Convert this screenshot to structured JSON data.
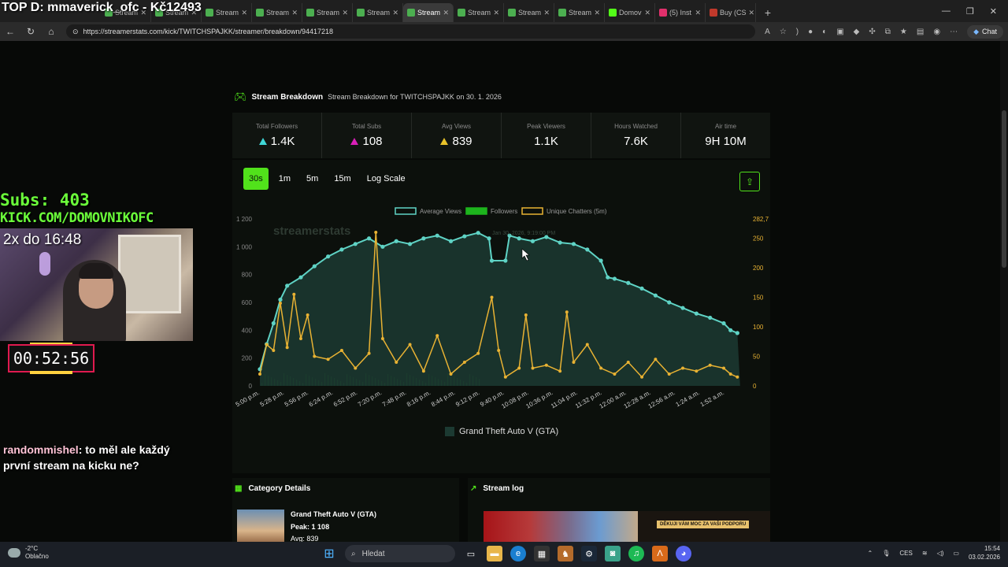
{
  "overlay_title": "TOP D: mmaverick_ofc - Kč12493",
  "tabs": [
    {
      "label": "Stream",
      "color": "#4caf50",
      "active": false
    },
    {
      "label": "Stream",
      "color": "#4caf50",
      "active": false
    },
    {
      "label": "Stream",
      "color": "#4caf50",
      "active": false
    },
    {
      "label": "Stream",
      "color": "#4caf50",
      "active": false
    },
    {
      "label": "Stream",
      "color": "#4caf50",
      "active": false
    },
    {
      "label": "Stream",
      "color": "#4caf50",
      "active": false
    },
    {
      "label": "Stream",
      "color": "#4caf50",
      "active": true
    },
    {
      "label": "Stream",
      "color": "#4caf50",
      "active": false
    },
    {
      "label": "Stream",
      "color": "#4caf50",
      "active": false
    },
    {
      "label": "Stream",
      "color": "#4caf50",
      "active": false
    },
    {
      "label": "Domov",
      "color": "#53fc18",
      "active": false
    },
    {
      "label": "(5) Inst",
      "color": "#e1306c",
      "active": false
    },
    {
      "label": "Buy (CS",
      "color": "#c0392b",
      "active": false
    }
  ],
  "address": {
    "url": "https://streamerstats.com/kick/TWITCHSPAJKK/streamer/breakdown/94417218",
    "chat_label": "Chat"
  },
  "stream_overlay": {
    "subs": "Subs: 403",
    "kick_url": "KICK.COM/DOMOVNIKOFC",
    "cam_text": "2x do 16:48",
    "timer": "00:52:56",
    "chat_user": "randommishel",
    "chat_text": ": to měl ale každý první stream na kicku ne?"
  },
  "breakdown": {
    "title": "Stream Breakdown",
    "subtitle": "Stream Breakdown for TWITCHSPAJKK on 30. 1. 2026"
  },
  "stats": [
    {
      "label": "Total Followers",
      "value": "1.4K",
      "icon_color": "#3fd6d6",
      "icon": "triangle-up-icon"
    },
    {
      "label": "Total Subs",
      "value": "108",
      "icon_color": "#d91fb8",
      "icon": "triangle-up-icon"
    },
    {
      "label": "Avg Views",
      "value": "839",
      "icon_color": "#e8c22a",
      "icon": "triangle-up-icon"
    },
    {
      "label": "Peak Viewers",
      "value": "1.1K"
    },
    {
      "label": "Hours Watched",
      "value": "7.6K"
    },
    {
      "label": "Air time",
      "value": "9H 10M"
    }
  ],
  "time_buttons": [
    "30s",
    "1m",
    "5m",
    "15m",
    "Log Scale"
  ],
  "active_time_button": "30s",
  "category_legend": "Grand Theft Auto V (GTA)",
  "category_details": {
    "title": "Category Details",
    "game": "Grand Theft Auto V (GTA)",
    "peak_label": "Peak:",
    "peak_value": "1 108",
    "avg_label": "Avg: 839"
  },
  "stream_log": {
    "title": "Stream log",
    "banner_text": "DĚKUJI VÁM MOC ZA VAŠI PODPORU"
  },
  "taskbar": {
    "temp": "-2°C",
    "weather": "Oblačno",
    "search": "Hledat",
    "lang": "CES",
    "time": "15:54",
    "date": "03.02.2026"
  },
  "chart_data": {
    "type": "line",
    "watermark": "streamerstats",
    "legend": [
      "Average Views",
      "Followers",
      "Unique Chatters (5m)"
    ],
    "colors": {
      "views": "#5fd3c5",
      "followers": "#1db41d",
      "chatters": "#e8b233",
      "fill": "#1c3a32"
    },
    "x_labels": [
      "5:00 p.m.",
      "5:28 p.m.",
      "5:56 p.m.",
      "6:24 p.m.",
      "6:52 p.m.",
      "7:20 p.m.",
      "7:48 p.m.",
      "8:16 p.m.",
      "8:44 p.m.",
      "9:12 p.m.",
      "9:40 p.m.",
      "10:08 p.m.",
      "10:36 p.m.",
      "11:04 p.m.",
      "11:32 p.m.",
      "12:00 a.m.",
      "12:28 a.m.",
      "12:56 a.m.",
      "1:24 a.m.",
      "1:52 a.m."
    ],
    "y_left": {
      "ticks": [
        "0",
        "200",
        "400",
        "600",
        "800",
        "1 000",
        "1 200"
      ],
      "ylim": [
        0,
        1200
      ]
    },
    "y_right": {
      "ticks": [
        "0",
        "50",
        "100",
        "150",
        "200",
        "250"
      ],
      "max_label": "282,7",
      "ylim": [
        0,
        282.7
      ]
    },
    "tooltip": "Jan 30, 2026, 9:19:00 PM",
    "views_series": [
      {
        "x": 0,
        "y": 120
      },
      {
        "x": 0.5,
        "y": 300
      },
      {
        "x": 1,
        "y": 450
      },
      {
        "x": 1.5,
        "y": 620
      },
      {
        "x": 2,
        "y": 720
      },
      {
        "x": 3,
        "y": 780
      },
      {
        "x": 4,
        "y": 860
      },
      {
        "x": 5,
        "y": 930
      },
      {
        "x": 6,
        "y": 980
      },
      {
        "x": 7,
        "y": 1020
      },
      {
        "x": 8,
        "y": 1060
      },
      {
        "x": 9,
        "y": 1000
      },
      {
        "x": 10,
        "y": 1040
      },
      {
        "x": 11,
        "y": 1020
      },
      {
        "x": 12,
        "y": 1060
      },
      {
        "x": 13,
        "y": 1080
      },
      {
        "x": 14,
        "y": 1040
      },
      {
        "x": 15,
        "y": 1075
      },
      {
        "x": 16,
        "y": 1100
      },
      {
        "x": 16.8,
        "y": 1060
      },
      {
        "x": 17,
        "y": 900
      },
      {
        "x": 18,
        "y": 900
      },
      {
        "x": 18.3,
        "y": 1080
      },
      {
        "x": 19,
        "y": 1060
      },
      {
        "x": 20,
        "y": 1040
      },
      {
        "x": 21,
        "y": 1070
      },
      {
        "x": 22,
        "y": 1030
      },
      {
        "x": 23,
        "y": 1020
      },
      {
        "x": 24,
        "y": 980
      },
      {
        "x": 25,
        "y": 900
      },
      {
        "x": 25.5,
        "y": 780
      },
      {
        "x": 26,
        "y": 770
      },
      {
        "x": 27,
        "y": 740
      },
      {
        "x": 28,
        "y": 700
      },
      {
        "x": 29,
        "y": 650
      },
      {
        "x": 30,
        "y": 600
      },
      {
        "x": 31,
        "y": 560
      },
      {
        "x": 32,
        "y": 520
      },
      {
        "x": 33,
        "y": 490
      },
      {
        "x": 34,
        "y": 450
      },
      {
        "x": 34.5,
        "y": 400
      },
      {
        "x": 35,
        "y": 380
      },
      {
        "x": 35.2,
        "y": 0
      }
    ],
    "chatters_series": [
      {
        "x": 0,
        "y": 20
      },
      {
        "x": 0.5,
        "y": 70
      },
      {
        "x": 1,
        "y": 60
      },
      {
        "x": 1.5,
        "y": 140
      },
      {
        "x": 2,
        "y": 65
      },
      {
        "x": 2.5,
        "y": 155
      },
      {
        "x": 3,
        "y": 80
      },
      {
        "x": 3.5,
        "y": 120
      },
      {
        "x": 4,
        "y": 50
      },
      {
        "x": 5,
        "y": 45
      },
      {
        "x": 6,
        "y": 60
      },
      {
        "x": 7,
        "y": 30
      },
      {
        "x": 8,
        "y": 55
      },
      {
        "x": 8.5,
        "y": 260
      },
      {
        "x": 9,
        "y": 80
      },
      {
        "x": 10,
        "y": 40
      },
      {
        "x": 11,
        "y": 70
      },
      {
        "x": 12,
        "y": 25
      },
      {
        "x": 13,
        "y": 85
      },
      {
        "x": 14,
        "y": 20
      },
      {
        "x": 15,
        "y": 40
      },
      {
        "x": 16,
        "y": 55
      },
      {
        "x": 17,
        "y": 150
      },
      {
        "x": 17.5,
        "y": 60
      },
      {
        "x": 18,
        "y": 15
      },
      {
        "x": 19,
        "y": 30
      },
      {
        "x": 19.5,
        "y": 120
      },
      {
        "x": 20,
        "y": 30
      },
      {
        "x": 21,
        "y": 35
      },
      {
        "x": 22,
        "y": 25
      },
      {
        "x": 22.5,
        "y": 125
      },
      {
        "x": 23,
        "y": 40
      },
      {
        "x": 24,
        "y": 70
      },
      {
        "x": 25,
        "y": 30
      },
      {
        "x": 26,
        "y": 20
      },
      {
        "x": 27,
        "y": 40
      },
      {
        "x": 28,
        "y": 15
      },
      {
        "x": 29,
        "y": 45
      },
      {
        "x": 30,
        "y": 20
      },
      {
        "x": 31,
        "y": 30
      },
      {
        "x": 32,
        "y": 25
      },
      {
        "x": 33,
        "y": 35
      },
      {
        "x": 34,
        "y": 30
      },
      {
        "x": 34.5,
        "y": 20
      },
      {
        "x": 35,
        "y": 15
      }
    ],
    "x_max": 35.5
  }
}
